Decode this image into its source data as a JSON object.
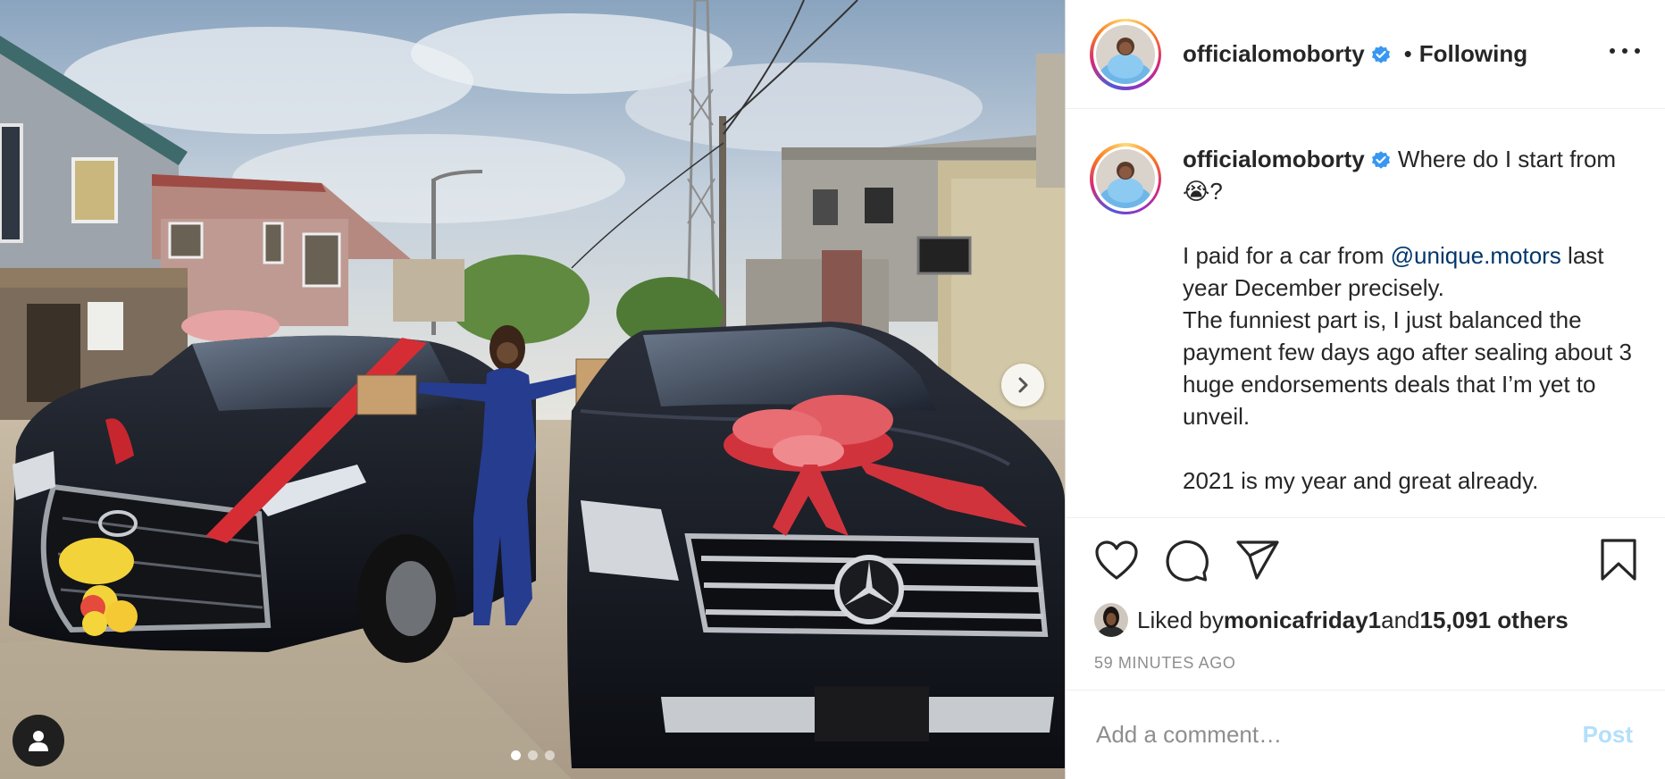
{
  "media": {
    "photo_icon": "photo-two-cars-gift-bow",
    "next_icon": "chevron-right-icon",
    "tags_icon": "user-tag-icon",
    "carousel": {
      "count": 3,
      "active_index": 0
    }
  },
  "header": {
    "avatar_icon": "profile-avatar",
    "username": "officialomoborty",
    "verified_icon": "verified-badge-icon",
    "separator": "•",
    "follow_status": "Following",
    "more_icon": "more-options-icon"
  },
  "caption": {
    "username": "officialomoborty",
    "intro": "Where do I start from 😭?",
    "line_pre_mention": "I paid for a car from ",
    "mention": "@unique.motors",
    "line_continued": "last year December precisely.",
    "paragraph": "The funniest part is, I just balanced the payment few days ago after sealing about 3 huge endorsements deals that I’m yet to unveil.",
    "closing": "2021 is my year and great already."
  },
  "actions": {
    "like_icon": "heart-icon",
    "comment_icon": "comment-icon",
    "share_icon": "share-paper-plane-icon",
    "save_icon": "bookmark-icon"
  },
  "likes": {
    "prefix": "Liked by ",
    "user": "monicafriday1",
    "connector": " and ",
    "others": "15,091 others"
  },
  "timestamp": "59 minutes ago",
  "comment": {
    "placeholder": "Add a comment…",
    "post_label": "Post",
    "post_color": "#b2dffc"
  },
  "colors": {
    "text": "#262626",
    "muted": "#8e8e8e",
    "mention": "#00376b",
    "verified": "#3897f0",
    "border": "#dbdbdb"
  }
}
